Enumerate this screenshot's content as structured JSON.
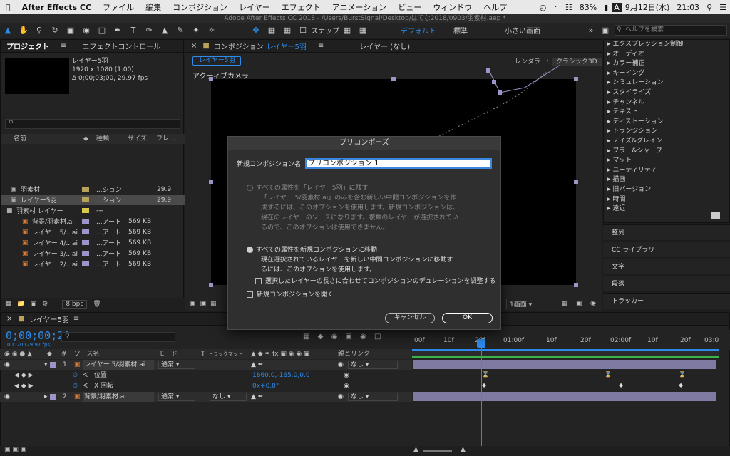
{
  "menubar": {
    "apple": "",
    "app": "After Effects CC",
    "items": [
      "ファイル",
      "編集",
      "コンポジション",
      "レイヤー",
      "エフェクト",
      "アニメーション",
      "ビュー",
      "ウィンドウ",
      "ヘルプ"
    ],
    "battery": "83%",
    "input": "A",
    "date": "9月12日(水)",
    "time": "21:03"
  },
  "window": {
    "title": "Adobe After Effects CC 2018 - /Users/BurstSignal/Desktop/はてな2018/0903/羽素材.aep *"
  },
  "toolbar": {
    "snap_label": "スナップ",
    "workspaces": [
      "デフォルト",
      "標準",
      "小さい画面"
    ],
    "help_placeholder": "ヘルプを検索"
  },
  "project": {
    "tabs": [
      "プロジェクト",
      "エフェクトコントロール "
    ],
    "selected_name": "レイヤー5羽",
    "selected_res": "1920 x 1080 (1.00)",
    "selected_dur": "Δ 0;00;03;00, 29.97 fps",
    "search_placeholder": "",
    "columns": [
      "名前",
      "種類",
      "サイズ",
      "フレ…"
    ],
    "rows": [
      {
        "name": "羽素材",
        "type": "...ション",
        "size": "",
        "fr": "29.9",
        "color": "#b8a25a"
      },
      {
        "name": "レイヤー5羽",
        "type": "...ション",
        "size": "",
        "fr": "29.9",
        "color": "#b8a25a"
      },
      {
        "name": "羽素材 レイヤー",
        "type": "---",
        "size": "",
        "fr": "",
        "color": "#d8c84a"
      },
      {
        "name": "背景/羽素材.ai",
        "type": "...アート",
        "size": "569 KB",
        "fr": "",
        "color": "#9b95c9"
      },
      {
        "name": "レイヤー 5/...ai",
        "type": "...アート",
        "size": "569 KB",
        "fr": "",
        "color": "#9b95c9"
      },
      {
        "name": "レイヤー 4/...ai",
        "type": "...アート",
        "size": "569 KB",
        "fr": "",
        "color": "#9b95c9"
      },
      {
        "name": "レイヤー 3/...ai",
        "type": "...アート",
        "size": "569 KB",
        "fr": "",
        "color": "#9b95c9"
      },
      {
        "name": "レイヤー 2/...ai",
        "type": "...アート",
        "size": "569 KB",
        "fr": "",
        "color": "#9b95c9"
      }
    ],
    "bpc": "8 bpc"
  },
  "comp": {
    "tab_prefix": "コンポジション",
    "tab_name": "レイヤー5羽",
    "layer_tab": "レイヤー (なし)",
    "subtab": "レイヤー5羽",
    "renderer_label": "レンダラー:",
    "renderer_value": "クラシック3D",
    "camera": "アクティブカメラ",
    "view_select": "1画面"
  },
  "effects_list": [
    "▸ エクスプレッション制御",
    "▸ オーディオ",
    "▸ カラー補正",
    "▸ キーイング",
    "▸ シミュレーション",
    "▸ スタイライズ",
    "▸ チャンネル",
    "▸ テキスト",
    "▸ ディストーション",
    "▸ トランジション",
    "▸ ノイズ&グレイン",
    "▸ ブラー&シャープ",
    "▸ マット",
    "▸ ユーティリティ",
    "▸ 描画",
    "▸ 旧バージョン",
    "▸ 時間",
    "▸ 遠近"
  ],
  "right_panels": [
    "整列",
    "CC ライブラリ",
    "文字",
    "段落",
    "トラッカー"
  ],
  "timeline": {
    "tab": "レイヤー5羽",
    "timecode": "0;00;00;20",
    "fps": "00020 (29.97 fps)",
    "col_source": "ソース名",
    "col_mode": "モード",
    "col_t": "T",
    "col_trkmat": "トラックマット",
    "col_parent": "親とリンク",
    "ruler": [
      ":00f",
      "10f",
      "20f",
      "01:00f",
      "10f",
      "20f",
      "02:00f",
      "10f",
      "20f",
      "03:0"
    ],
    "layers": [
      {
        "num": "1",
        "name": "レイヤー 5/羽素材.ai",
        "mode": "通常",
        "trkmat": "",
        "parent": "なし"
      },
      {
        "num": "2",
        "name": "背景/羽素材.ai",
        "mode": "通常",
        "trkmat": "なし",
        "parent": "なし"
      }
    ],
    "props": [
      {
        "name": "位置",
        "value": "1860.0,-165.0,0.0"
      },
      {
        "name": "X 回転",
        "value": "0x+0.0°"
      }
    ]
  },
  "dialog": {
    "title": "プリコンポーズ",
    "name_label": "新規コンポジション名:",
    "name_value": "プリコンポジション 1",
    "opt1": "すべての属性を「レイヤー5羽」に残す",
    "opt1_desc": [
      "「レイヤー 5/羽素材.ai」のみを含む新しい中間コンポジションを作",
      "成するには、このオプションを使用します。新規コンポジションは、",
      "現在のレイヤーのソースになります。複数のレイヤーが選択されてい",
      "るので、このオプションは使用できません。"
    ],
    "opt2": "すべての属性を新規コンポジションに移動",
    "opt2_desc": [
      "現在選択されているレイヤーを新しい中間コンポジションに移動す",
      "るには、このオプションを使用します。"
    ],
    "chk1": "選択したレイヤーの長さに合わせてコンポジションのデュレーションを調整する",
    "chk2": "新規コンポジションを開く",
    "cancel": "キャンセル",
    "ok": "OK"
  }
}
